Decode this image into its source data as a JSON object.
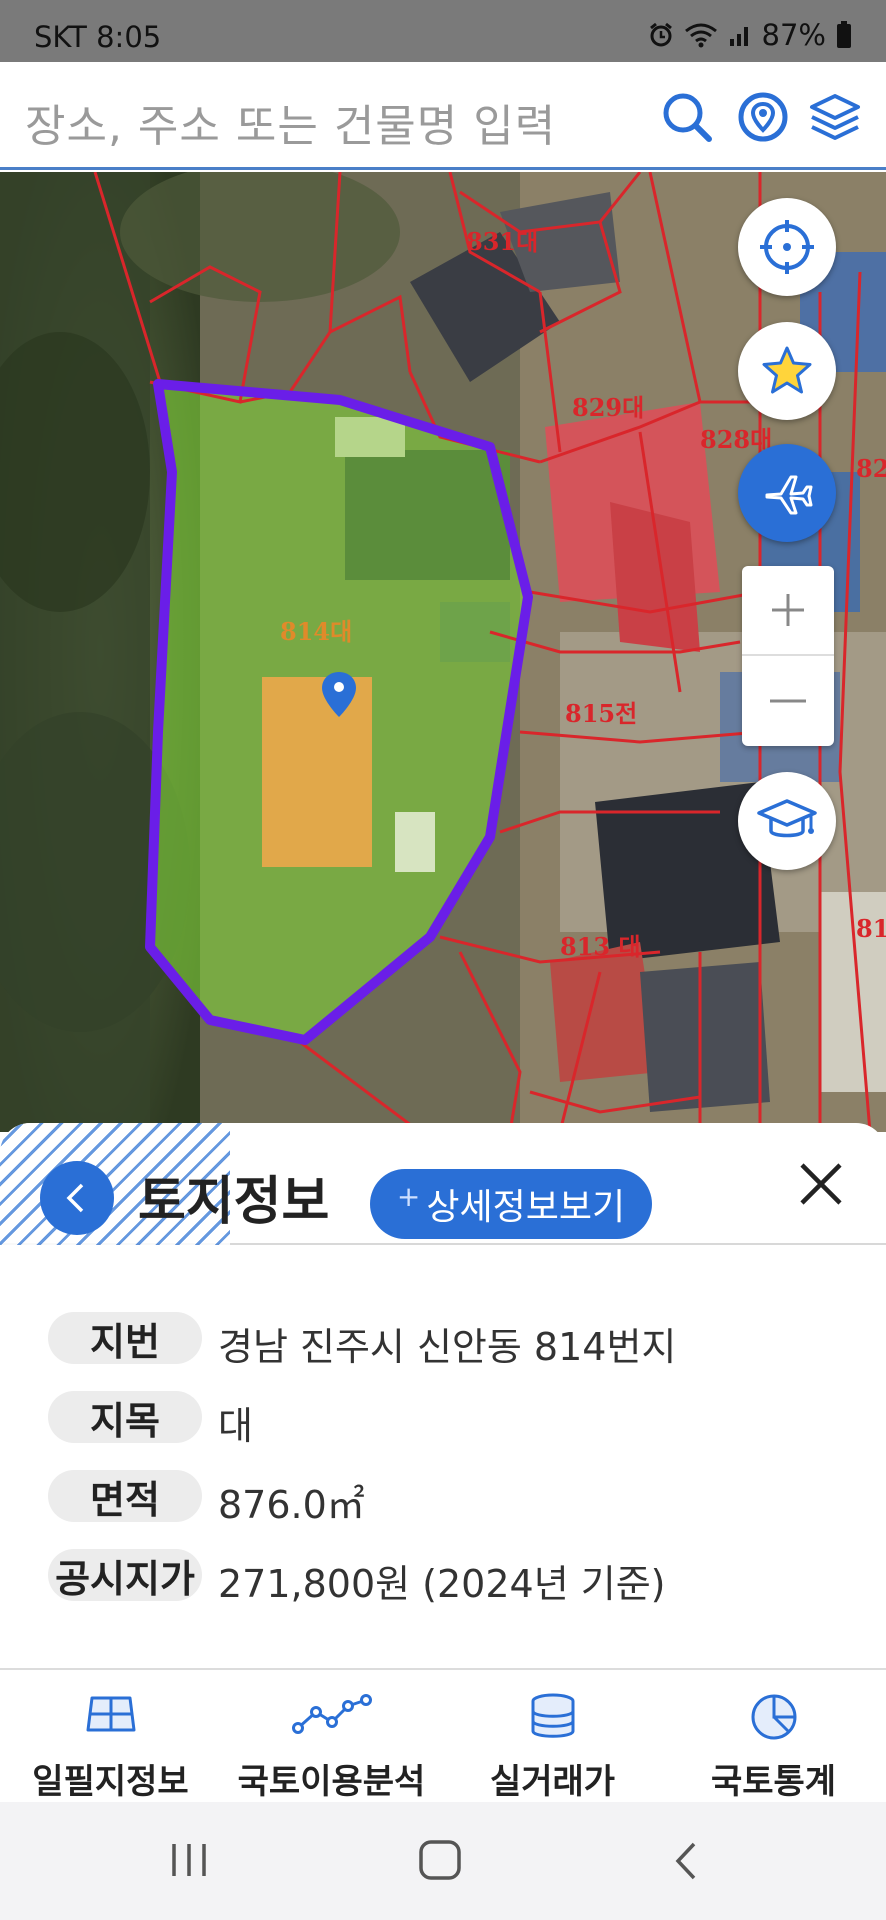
{
  "status_bar": {
    "carrier_time": "SKT 8:05",
    "battery": "87%"
  },
  "search": {
    "placeholder": "장소, 주소 또는 건물명 입력"
  },
  "map": {
    "parcel_labels": [
      "831대",
      "829대",
      "828대",
      "814대",
      "815전",
      "813 대",
      "82",
      "81"
    ],
    "colors": {
      "parcel_outline": "#d9262b",
      "selected_outline": "#6a1ee8",
      "selected_fill": "#7fd13a"
    }
  },
  "sheet": {
    "title": "토지정보",
    "detail_button": "상세정보보기",
    "rows": [
      {
        "label": "지번",
        "value": "경남 진주시 신안동 814번지"
      },
      {
        "label": "지목",
        "value": "대"
      },
      {
        "label": "면적",
        "value": "876.0㎡"
      },
      {
        "label": "공시지가",
        "value": "271,800원 (2024년 기준)"
      }
    ]
  },
  "bottom_nav": {
    "items": [
      {
        "label": "일필지정보",
        "icon": "parcel-grid-icon"
      },
      {
        "label": "국토이용분석",
        "icon": "line-chart-icon"
      },
      {
        "label": "실거래가",
        "icon": "database-icon"
      },
      {
        "label": "국토통계",
        "icon": "pie-chart-icon"
      }
    ]
  },
  "theme": {
    "accent": "#2a6fd6"
  }
}
